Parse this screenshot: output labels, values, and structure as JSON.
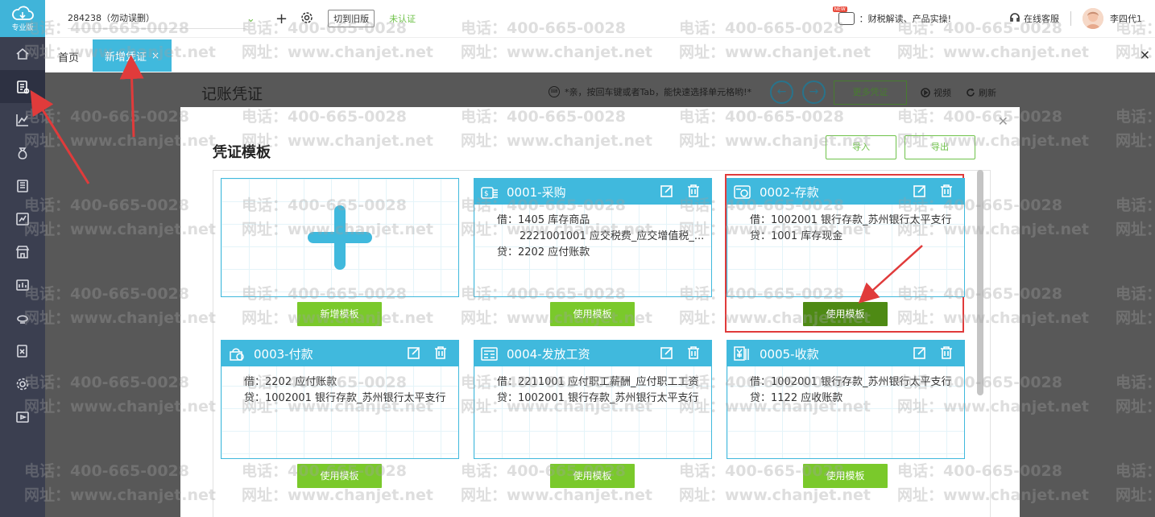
{
  "logo": {
    "label": "专业版"
  },
  "topbar": {
    "account": "284238（勿动误删）",
    "old_version": "切到旧版",
    "unverified": "未认证",
    "news": "：财税解读、产品实操!",
    "new_badge": "NEW",
    "service": "在线客服",
    "username": "李四代1"
  },
  "tabs": {
    "home": "首页",
    "active": "新增凭证",
    "close": "×"
  },
  "page": {
    "title": "记账凭证",
    "hint": "*亲，按回车键或者Tab，能快速选择单元格哟!*",
    "more": "更多凭证",
    "video": "视频",
    "refresh": "刷新"
  },
  "modal": {
    "title": "凭证模板",
    "import": "导入",
    "export": "导出",
    "new_template": "新增模板",
    "use_label": "使用模板"
  },
  "templates": [
    {
      "title": "0001-采购",
      "lines": [
        "借：1405 库存商品",
        "2221001001 应交税费_应交增值税_...",
        "贷：2202 应付账款"
      ]
    },
    {
      "title": "0002-存款",
      "lines": [
        "借：1002001 银行存款_苏州银行太平支行",
        "贷：1001 库存现金"
      ]
    },
    {
      "title": "0003-付款",
      "lines": [
        "借：2202 应付账款",
        "贷：1002001 银行存款_苏州银行太平支行"
      ]
    },
    {
      "title": "0004-发放工资",
      "lines": [
        "借：2211001 应付职工薪酬_应付职工工资",
        "贷：1002001 银行存款_苏州银行太平支行"
      ]
    },
    {
      "title": "0005-收款",
      "lines": [
        "借：1002001 银行存款_苏州银行太平支行",
        "贷：1122 应收账款"
      ]
    }
  ],
  "watermark": {
    "phone": "电话：400-665-0028",
    "site": "网址：www.chanjet.net"
  },
  "colors": {
    "accent": "#40b9dd",
    "green": "#7ac92b",
    "sidebar": "#3b3f50",
    "highlight": "#e03b3b"
  }
}
